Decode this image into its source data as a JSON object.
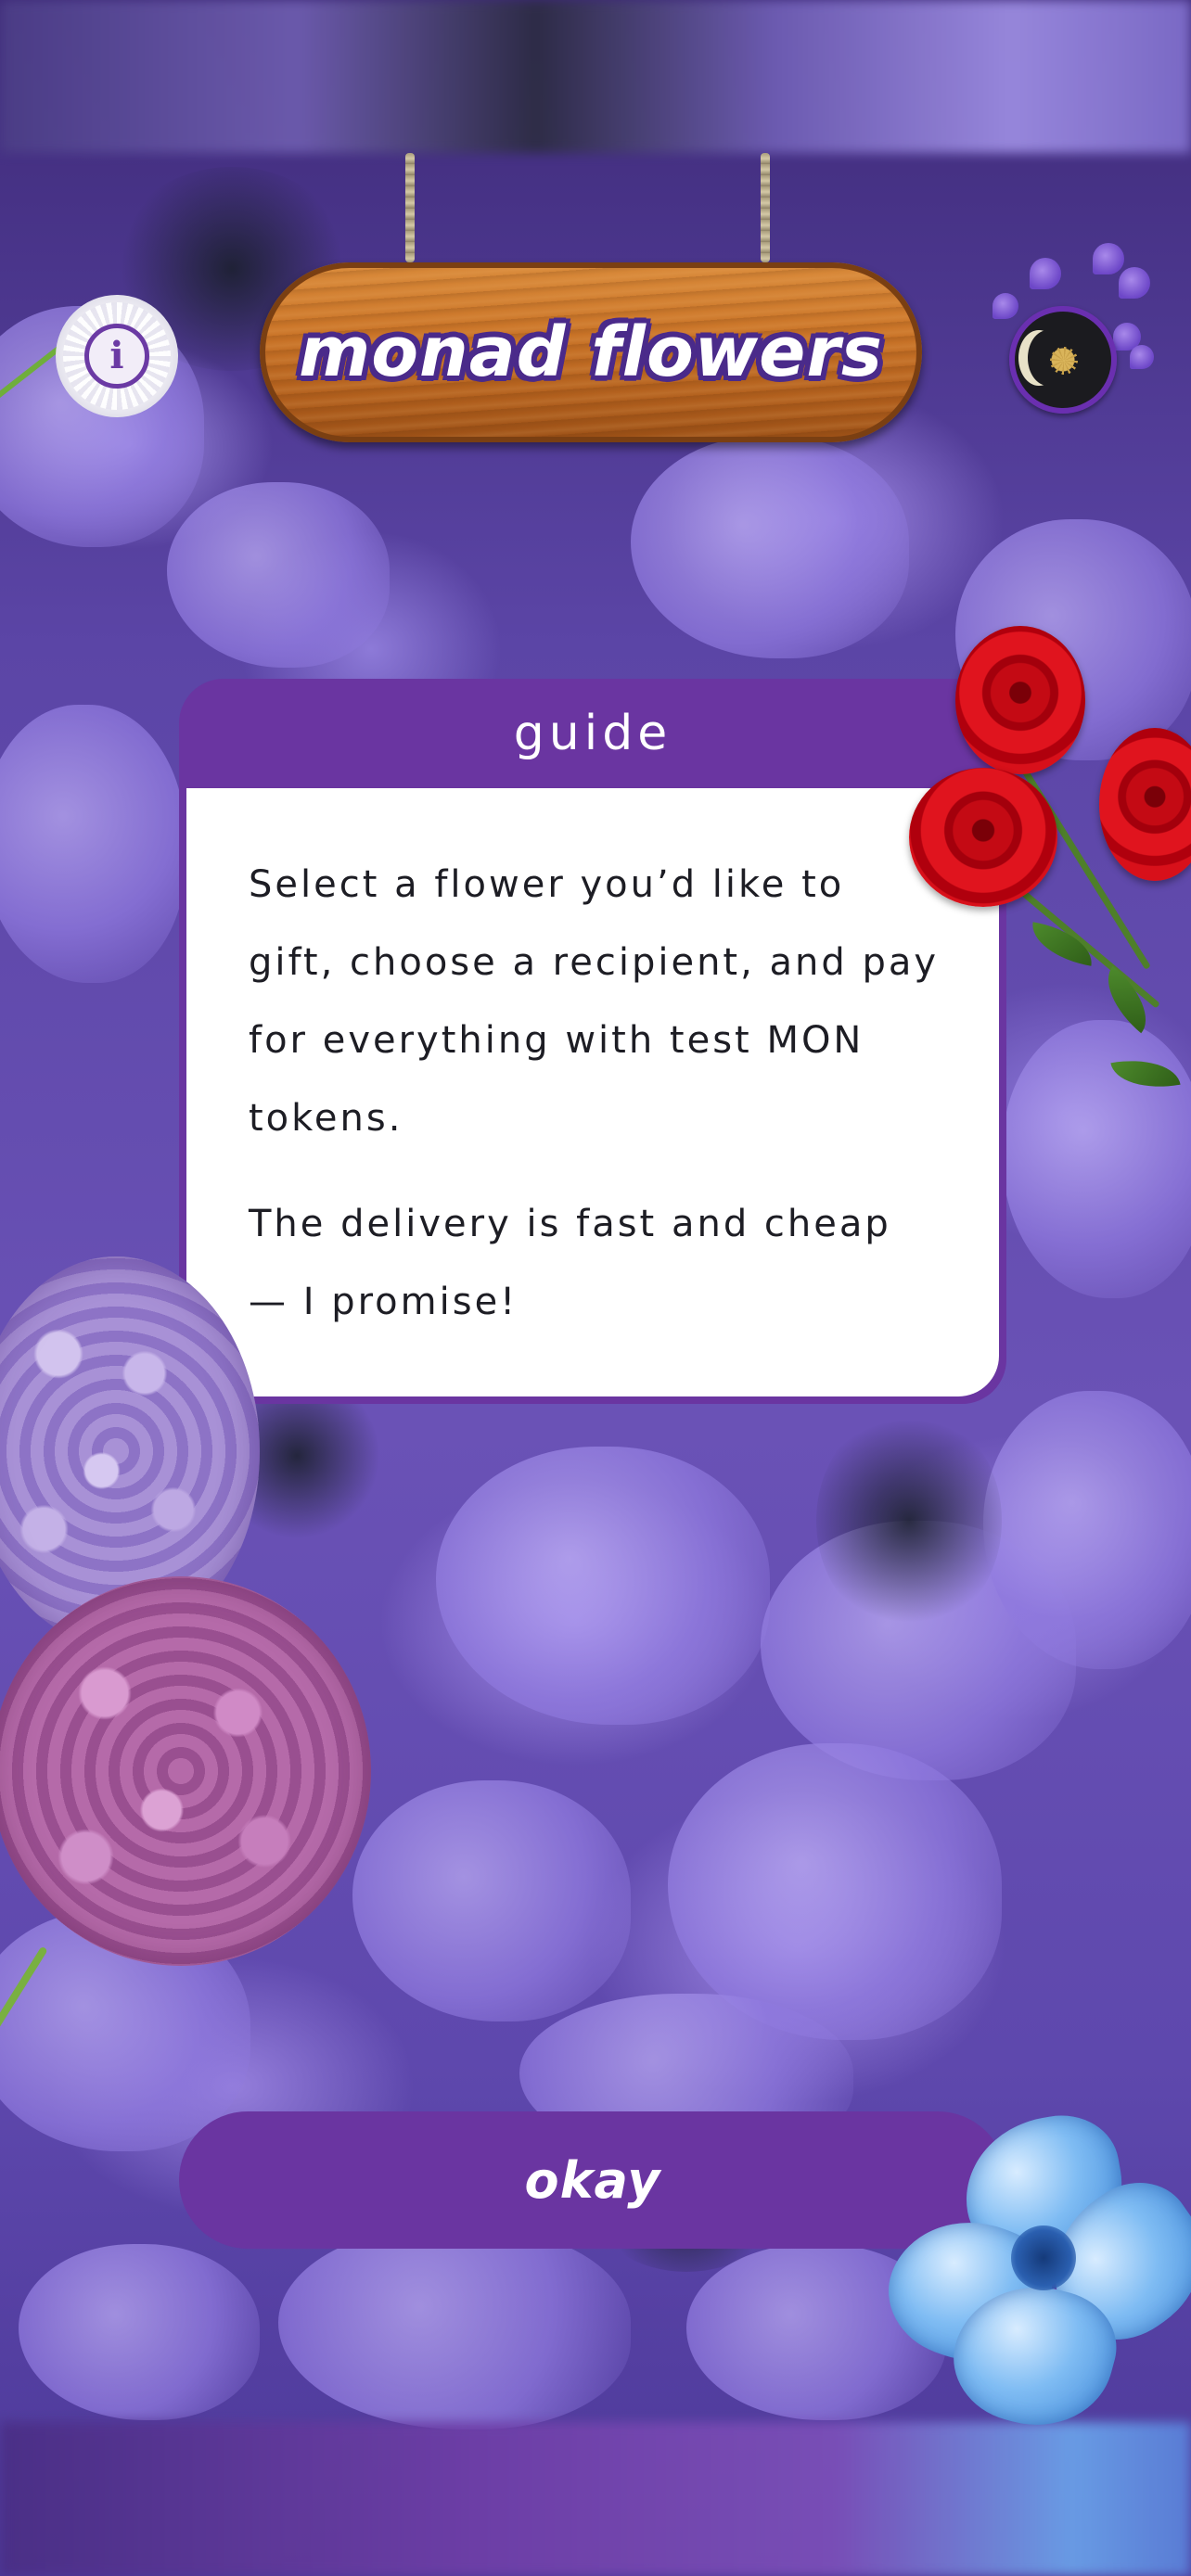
{
  "header": {
    "title": "monad flowers",
    "info_icon": "info-icon",
    "profile_icon": "profile-avatar-icon"
  },
  "guide": {
    "title": "guide",
    "paragraphs": [
      "Select a flower you’d like to gift, choose a recipient, and pay for everything with test MON tokens.",
      "The delivery is fast and cheap — I promise!"
    ]
  },
  "actions": {
    "okay_label": "okay"
  },
  "colors": {
    "accent_purple": "#6a35a1",
    "sign_wood": "#c97327",
    "sign_outline": "#4a2a8a",
    "card_body": "#ffffff",
    "text_dark": "#1d1d24"
  },
  "decorations": [
    "rope-icon",
    "red-roses-icon",
    "lilac-hydrangea-icon",
    "pink-hydrangea-icon",
    "blue-flower-icon",
    "violet-flowers-icon"
  ]
}
